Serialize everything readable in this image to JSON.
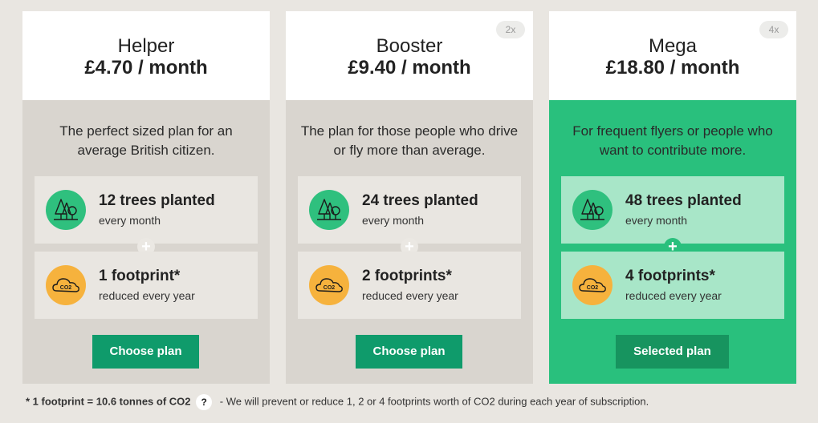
{
  "plans": [
    {
      "name": "Helper",
      "price": "£4.70 / month",
      "multiplier": "",
      "description": "The perfect sized plan for an average British citizen.",
      "trees_title": "12 trees planted",
      "trees_sub": "every month",
      "footprint_title": "1 footprint*",
      "footprint_sub": "reduced every year",
      "plus": "+",
      "button": "Choose plan",
      "selected": false
    },
    {
      "name": "Booster",
      "price": "£9.40 / month",
      "multiplier": "2x",
      "description": "The plan for those people who drive or fly more than average.",
      "trees_title": "24 trees planted",
      "trees_sub": "every month",
      "footprint_title": "2 footprints*",
      "footprint_sub": "reduced every year",
      "plus": "+",
      "button": "Choose plan",
      "selected": false
    },
    {
      "name": "Mega",
      "price": "£18.80 / month",
      "multiplier": "4x",
      "description": "For frequent flyers or people who want to contribute more.",
      "trees_title": "48 trees planted",
      "trees_sub": "every month",
      "footprint_title": "4 footprints*",
      "footprint_sub": "reduced every year",
      "plus": "+",
      "button": "Selected plan",
      "selected": true
    }
  ],
  "icons": {
    "trees": "trees-icon",
    "co2": "co2-cloud-icon",
    "co2_label": "CO2"
  },
  "colors": {
    "background": "#e9e6e1",
    "card": "#d9d5cf",
    "selected_card": "#29c07d",
    "selected_benefit": "#a8e6c8",
    "button": "#0f9b6b",
    "tree_icon": "#2fc07e",
    "co2_icon": "#f6b23d"
  },
  "footnote": {
    "bold": "* 1 footprint = 10.6 tonnes of CO2",
    "help": "?",
    "text": "- We will prevent or reduce 1, 2 or 4 footprints worth of CO2 during each year of subscription."
  }
}
